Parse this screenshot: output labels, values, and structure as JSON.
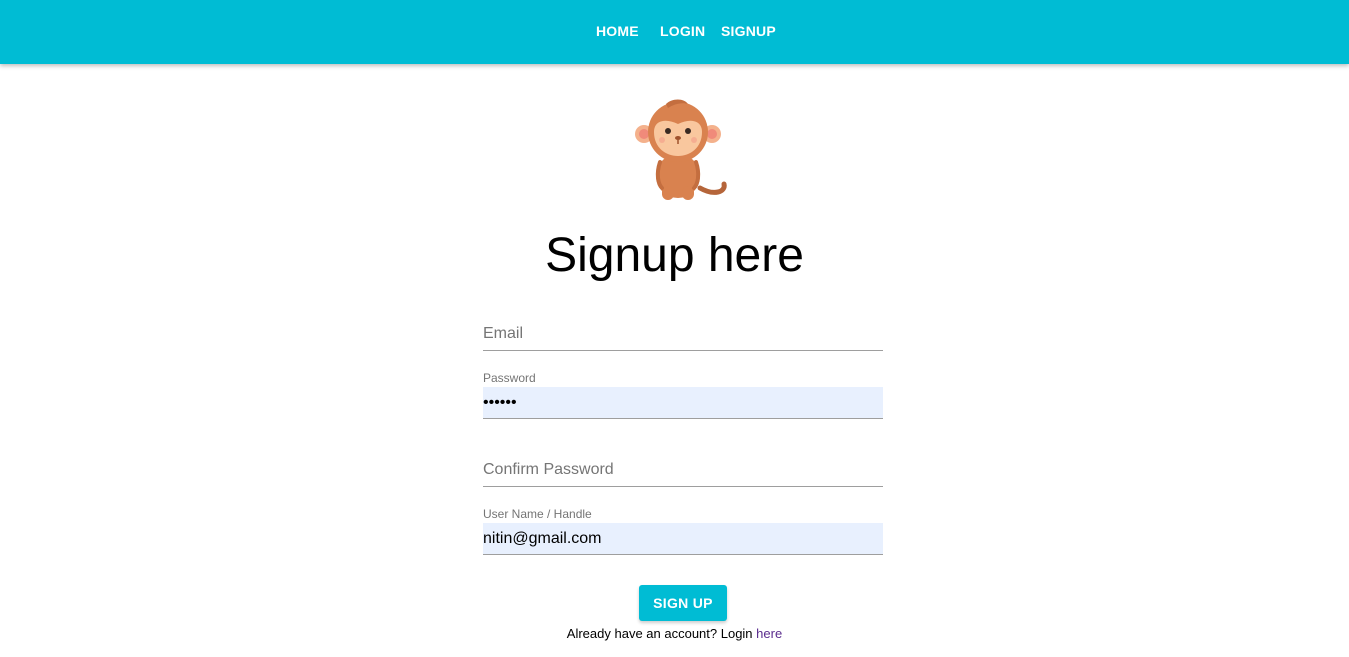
{
  "nav": {
    "home": "HOME",
    "login": "LOGIN",
    "signup": "SIGNUP"
  },
  "page": {
    "title": "Signup here"
  },
  "form": {
    "email": {
      "placeholder": "Email",
      "value": ""
    },
    "password": {
      "label": "Password",
      "value": "••••••"
    },
    "confirm_password": {
      "placeholder": "Confirm Password",
      "value": ""
    },
    "username": {
      "label": "User Name / Handle",
      "value": "nitin@gmail.com"
    },
    "submit_label": "SIGN UP"
  },
  "footer": {
    "prompt": "Already have an account? Login ",
    "link": "here"
  },
  "colors": {
    "accent": "#00bcd4",
    "autofill_bg": "#e8f0fe",
    "link": "#5b2d8e"
  },
  "icons": {
    "logo": "monkey-icon"
  }
}
